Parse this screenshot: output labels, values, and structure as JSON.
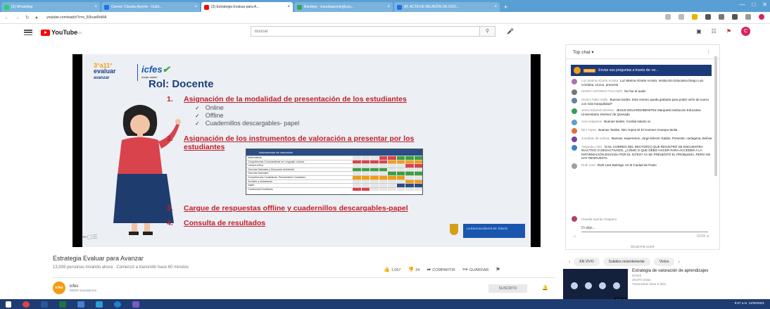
{
  "browser": {
    "tabs": [
      {
        "title": "(3) WhatsApp",
        "color": "#25d366",
        "active": false
      },
      {
        "title": "Correo: Claudia Aponte - Outlo...",
        "color": "#1a73e8",
        "active": false
      },
      {
        "title": "(3) Estrategia Evaluar para A...",
        "color": "#ff0000",
        "active": true
      },
      {
        "title": "Bandeja - claudiaaponte@ucu...",
        "color": "#34a853",
        "active": false
      },
      {
        "title": "AT. ACTA DE REUNIÓN DE DOC...",
        "color": "#1a73e8",
        "active": false
      }
    ],
    "new_tab": "+",
    "url": "youtube.com/watch?v=s_5l3ruwRrk8A"
  },
  "youtube": {
    "logo": "YouTube",
    "logo_sup": "CO",
    "search_placeholder": "Buscar",
    "avatar_letter": "C"
  },
  "slide": {
    "logo_top": "3°a11°",
    "logo_mid": "evaluar",
    "logo_bot": "avanzar",
    "icfes": "icfes",
    "icfes_sub": "mejor saber",
    "title": "Rol: Docente",
    "items": [
      {
        "num": "1.",
        "text": "Asignación de la modalidad de presentación de los estudiantes"
      },
      {
        "num": "2.",
        "text": "Asignación de los instrumentos de valoración a presentar por los"
      },
      {
        "num": "3.",
        "text": "Cargue de respuestas offline y cuadernillos descargables-papel"
      },
      {
        "num": "4.",
        "text": "Consulta de resultados"
      }
    ],
    "item2_cont": "estudiantes",
    "subitems": [
      "Online",
      "Offline",
      "Cuadernillos descargables- papel"
    ],
    "table_header": "Instrumentos de valoración",
    "table_rows": [
      "Matemáticas",
      "Competencias Comunicativas en Lenguaje: Lectura",
      "Lectura crítica",
      "Ciencias Naturales y Educación Ambiental",
      "Ciencias Naturales",
      "Competencias Ciudadanas: Pensamiento Ciudadano",
      "Sociales y ciudadanas",
      "Inglés",
      "Cuestionario Auxiliares"
    ],
    "footer_logo": "LA EDUCACIÓN ES DE TODOS"
  },
  "video": {
    "title": "Estrategia Evaluar para Avanzar",
    "meta": "13,939 personas mirando ahora · Comenzó a transmitir hace 60 minutos",
    "likes": "1,067",
    "dislikes": "24",
    "share": "COMPARTIR",
    "save": "GUARDAR",
    "channel": "icfes",
    "subscribers": "86000 suscriptores",
    "subscribe": "SUSCRITO",
    "channel_short": "icfes"
  },
  "chat": {
    "header": "Top chat",
    "pinned_tag": "ICFES",
    "pinned_text": "Enviar sus preguntas a través de: ev...",
    "messages": [
      {
        "author": "Luz Marina Alzarte Acosta",
        "text": "Luz Marina Alzarte Acosta. Institución Educativa Diego Luis Córdoba, Lloroo, presente.",
        "color": "#b06fb0"
      },
      {
        "author": "MARIO ANTONIO FALCHER",
        "text": "No fue el audio",
        "color": "#777777"
      },
      {
        "author": "Hector Fabio Gallo",
        "text": "Buenas tardes. Este evento queda grabado para poder verlo de nuevo con más tranquilidad?",
        "color": "#6a7fa8"
      },
      {
        "author": "Jesús Eduardo Benítez",
        "text": "JESUS EDUARDOBENITEZ Marquetá Institución Educativa Universitaria Jiménez de Quesada",
        "color": "#3a9a5b"
      },
      {
        "author": "Ana Holguinos",
        "text": "Buenas tardes. Cordial saludo xx",
        "color": "#5aa0d0"
      },
      {
        "author": "Nini Yopes",
        "text": "Buenas Tardes, Nini Yopes IE El Carmen Ocampo Mulia",
        "color": "#e0703c"
      },
      {
        "author": "Jonathan de salinas",
        "text": "Buenas, esperemos ,Jorge Eliecer Gaitán, Presente, cartagena, Bolívar",
        "color": "#7a3fa0"
      },
      {
        "author": "Alejandro Ortiz",
        "text": "SI EL CORREO DEL RECTOR(A) QUE REGISTRÓ SE ENCUENTRA INACTIVO O DESACTIVADO, ¿CÓMO O QUE DEBO HACER PARA ACCEDER A LA INFORMACIÓN ENVIADA POR EL ICFES? YA SE PRESENTÓ EL PROBLEMA, PERO NO HAY RESPUESTA",
        "color": "#3f7fbf"
      },
      {
        "author": "Ruth Lara",
        "text": "Ruth Lara Buitrago I.E.M Ciudad de Pasto",
        "color": "#a0a0a0"
      }
    ],
    "input_name": "Claudia Aponte Chaparro",
    "input_placeholder": "Di algo...",
    "char_count": "0/200",
    "hide": "OCULTAR CHAT"
  },
  "related": {
    "chips": [
      "EN VIVO",
      "Subidos recientemente",
      "Vistos"
    ],
    "title": "Estrategia de valoración de aprendizajes",
    "channel": "ICFES",
    "views": "29,870 vistas ·",
    "age": "Transmitido hace 9 días",
    "duration": "2:08:18"
  },
  "taskbar": {
    "time": "9:07 a.m.",
    "date": "11/05/2021"
  },
  "colors": {
    "accent": "#ff0000",
    "slide_red": "#c0202a",
    "slide_blue": "#1b3f7a"
  }
}
